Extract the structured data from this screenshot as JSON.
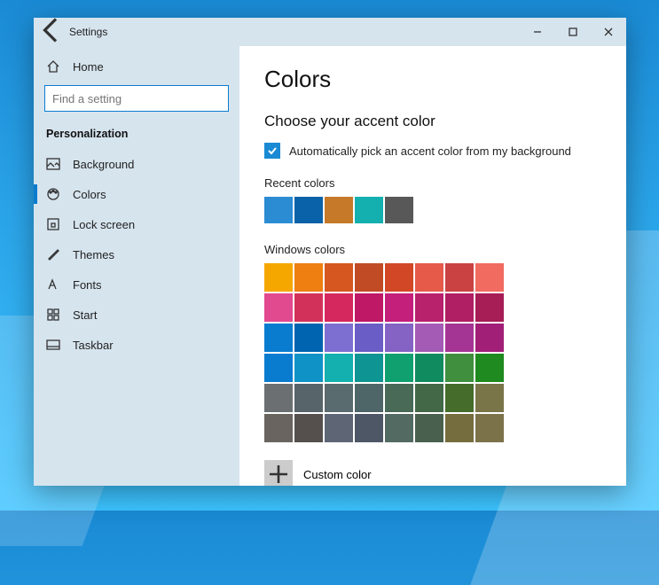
{
  "window": {
    "title": "Settings"
  },
  "sidebar": {
    "home": "Home",
    "search_placeholder": "Find a setting",
    "header": "Personalization",
    "items": [
      {
        "label": "Background"
      },
      {
        "label": "Colors"
      },
      {
        "label": "Lock screen"
      },
      {
        "label": "Themes"
      },
      {
        "label": "Fonts"
      },
      {
        "label": "Start"
      },
      {
        "label": "Taskbar"
      }
    ]
  },
  "main": {
    "heading": "Colors",
    "subheading": "Choose your accent color",
    "auto_pick_label": "Automatically pick an accent color from my background",
    "recent_label": "Recent colors",
    "recent_colors": [
      "#2b8cd4",
      "#0a62a8",
      "#c67a29",
      "#14b0b0",
      "#585858"
    ],
    "windows_colors_label": "Windows colors",
    "windows_colors": [
      "#f5a700",
      "#ee7f10",
      "#d65720",
      "#c14b24",
      "#d24726",
      "#e65a4a",
      "#ca4242",
      "#f26b60",
      "#e24a8f",
      "#d2325a",
      "#d5285e",
      "#be1866",
      "#c31f7b",
      "#b8216c",
      "#b01e63",
      "#a71d56",
      "#0a7cd0",
      "#0064b0",
      "#7d6fd1",
      "#6b5dc6",
      "#8463c5",
      "#a45bb5",
      "#a53594",
      "#a21f78",
      "#0a7cd0",
      "#0f93c7",
      "#14b0b0",
      "#0f9494",
      "#10a070",
      "#0f8b5f",
      "#3f8f3f",
      "#1f8a1f",
      "#6b6f72",
      "#576469",
      "#5a6b70",
      "#4f6668",
      "#486a56",
      "#436847",
      "#466c2c",
      "#7a7548",
      "#6a6460",
      "#55504d",
      "#5e6676",
      "#4e5766",
      "#536a63",
      "#4a604e",
      "#766d3e",
      "#7c724a"
    ],
    "custom_label": "Custom color"
  }
}
